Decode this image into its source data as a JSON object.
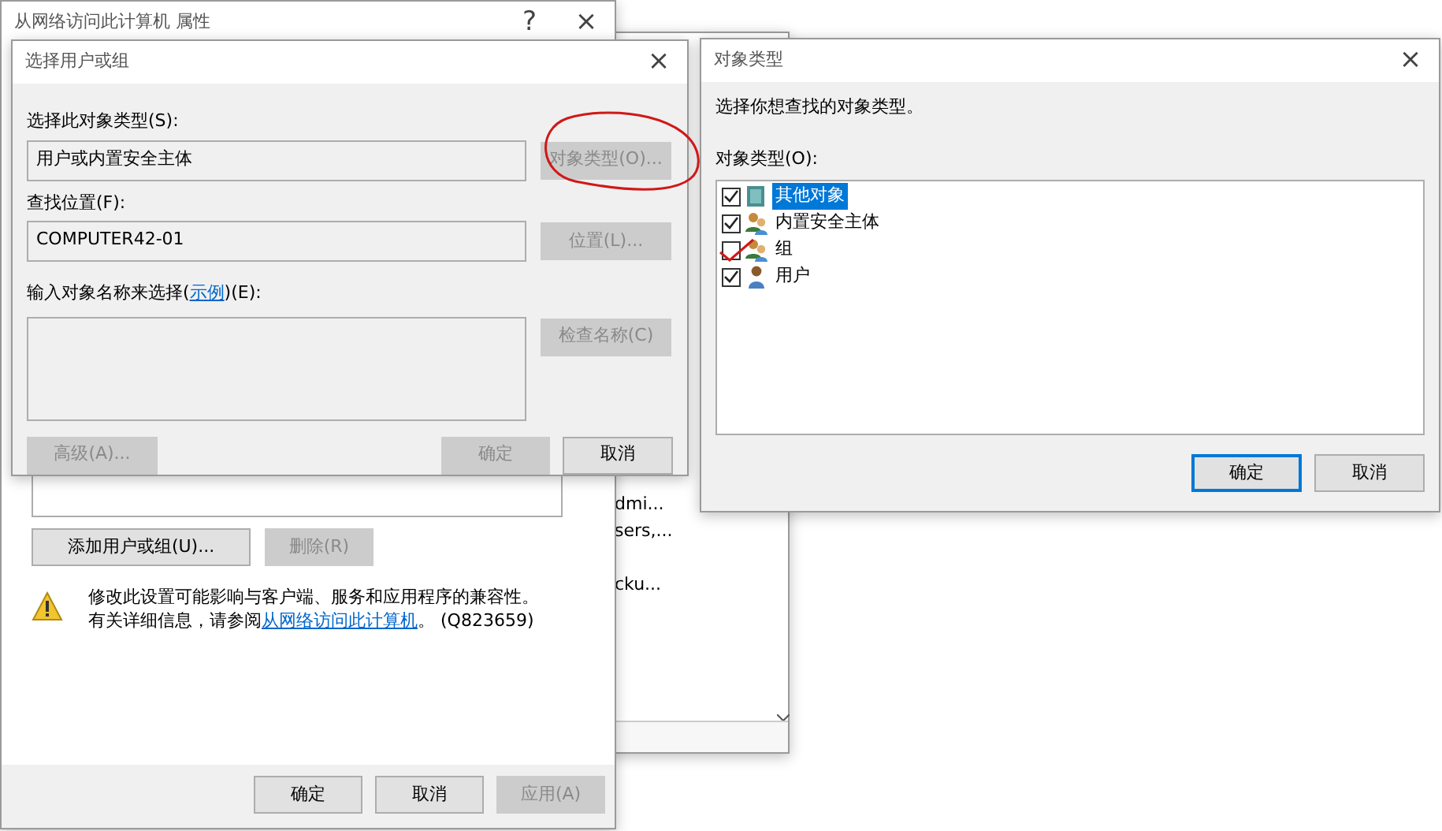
{
  "properties_window": {
    "title": "从网络访问此计算机 属性",
    "help_glyph": "?",
    "close_glyph": "×",
    "buttons": [
      {
        "label": "添加用户或组(U)...",
        "disabled": false
      },
      {
        "label": "删除(R)",
        "disabled": true
      }
    ],
    "warning": {
      "line1": "修改此设置可能影响与客户端、服务和应用程序的兼容性。",
      "line2_prefix": "有关详细信息，请参阅",
      "link": "从网络访问此计算机",
      "line2_suffix": "。 (Q823659)"
    },
    "footer_buttons": [
      {
        "label": "确定",
        "disabled": false
      },
      {
        "label": "取消",
        "disabled": false
      },
      {
        "label": "应用(A)",
        "disabled": true
      }
    ]
  },
  "background_list": {
    "items": [
      "dmi...",
      "sers,...",
      "cku..."
    ]
  },
  "select_dialog": {
    "title": "选择用户或组",
    "close_glyph": "×",
    "object_type_label": "选择此对象类型(S):",
    "object_type_value": "用户或内置安全主体",
    "object_type_button": {
      "label": "对象类型(O)...",
      "disabled": true,
      "circled": true
    },
    "location_label": "查找位置(F):",
    "location_value": "COMPUTER42-01",
    "location_button": {
      "label": "位置(L)...",
      "disabled": true
    },
    "names_label_prefix": "输入对象名称来选择(",
    "names_link": "示例",
    "names_label_suffix": ")(E):",
    "check_button": {
      "label": "检查名称(C)",
      "disabled": true
    },
    "advanced_button": {
      "label": "高级(A)...",
      "disabled": true
    },
    "ok_button": {
      "label": "确定",
      "disabled": true
    },
    "cancel_button": {
      "label": "取消",
      "disabled": false
    }
  },
  "object_types_dialog": {
    "title": "对象类型",
    "close_glyph": "×",
    "prompt": "选择你想查找的对象类型。",
    "list_label": "对象类型(O):",
    "items": [
      {
        "label": "其他对象",
        "checked": true,
        "selected": true,
        "annotated": false,
        "kind": "other"
      },
      {
        "label": "内置安全主体",
        "checked": true,
        "selected": false,
        "annotated": false,
        "kind": "builtin"
      },
      {
        "label": "组",
        "checked": false,
        "selected": false,
        "annotated": true,
        "kind": "group"
      },
      {
        "label": "用户",
        "checked": true,
        "selected": false,
        "annotated": false,
        "kind": "user"
      }
    ],
    "buttons": [
      {
        "label": "确定",
        "default": true
      },
      {
        "label": "取消",
        "default": false
      }
    ]
  }
}
